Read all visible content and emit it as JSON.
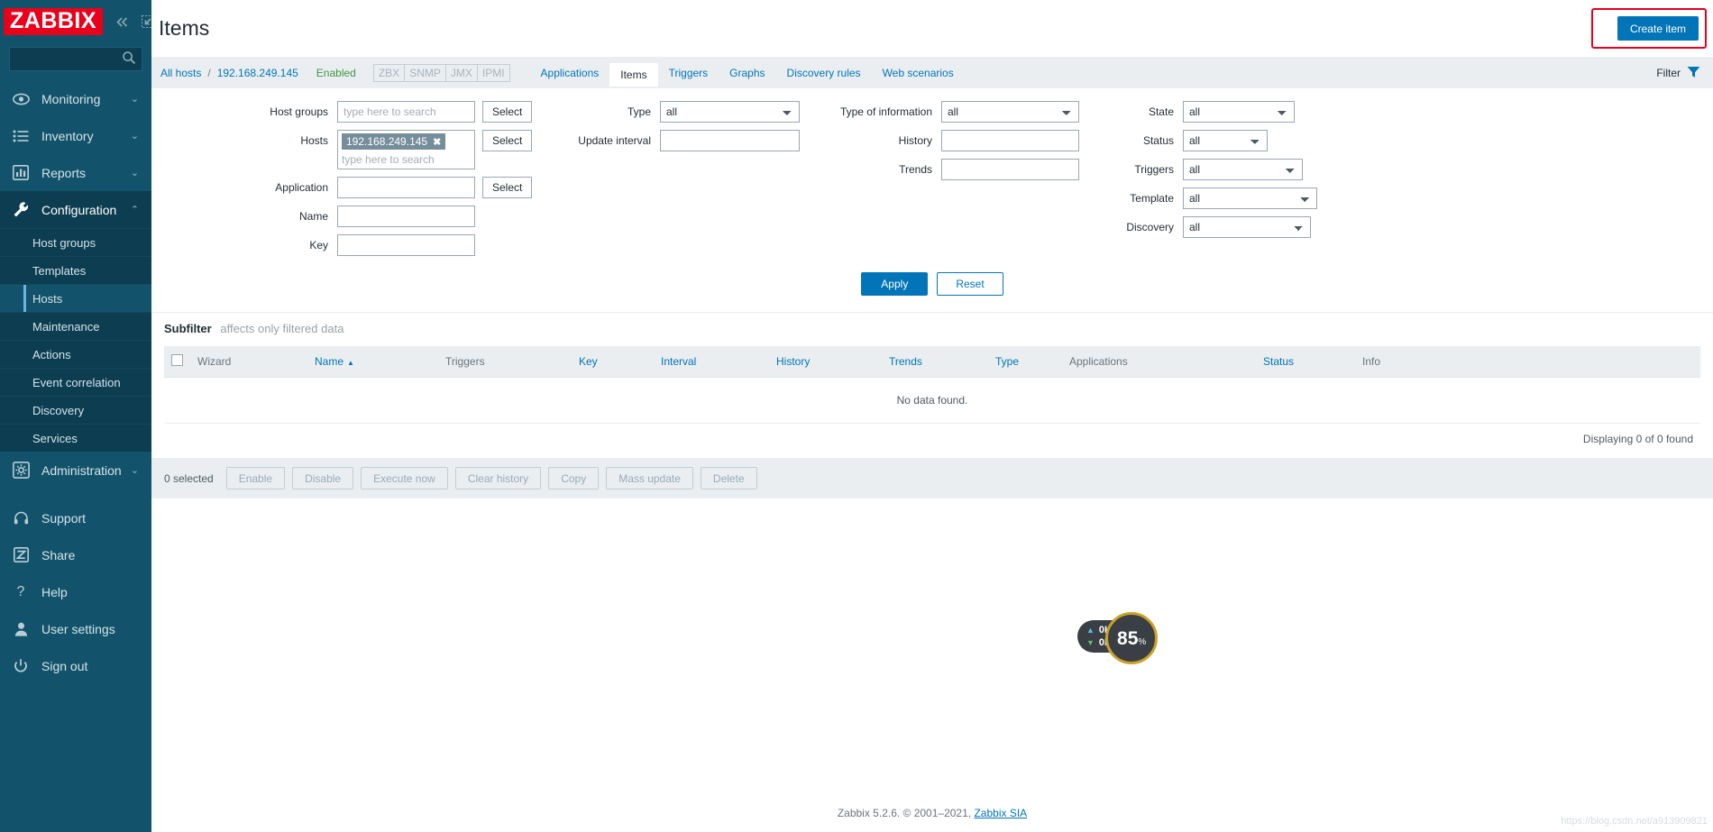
{
  "sidebar": {
    "logo": "ZABBIX",
    "collapse_icon": "chevron-double-left-icon",
    "expand_icon": "collapse-window-icon",
    "search": {
      "value": "",
      "placeholder": ""
    },
    "nav": [
      {
        "label": "Monitoring",
        "icon": "eye-icon",
        "chevron": "⌄",
        "active": false
      },
      {
        "label": "Inventory",
        "icon": "list-icon",
        "chevron": "⌄",
        "active": false
      },
      {
        "label": "Reports",
        "icon": "bar-chart-icon",
        "chevron": "⌄",
        "active": false
      },
      {
        "label": "Configuration",
        "icon": "wrench-icon",
        "chevron": "⌃",
        "active": true
      }
    ],
    "submenu": [
      {
        "label": "Host groups",
        "selected": false
      },
      {
        "label": "Templates",
        "selected": false
      },
      {
        "label": "Hosts",
        "selected": true
      },
      {
        "label": "Maintenance",
        "selected": false
      },
      {
        "label": "Actions",
        "selected": false
      },
      {
        "label": "Event correlation",
        "selected": false
      },
      {
        "label": "Discovery",
        "selected": false
      },
      {
        "label": "Services",
        "selected": false
      }
    ],
    "nav_admin": {
      "label": "Administration",
      "icon": "gear-icon",
      "chevron": "⌄"
    },
    "bottom": [
      {
        "label": "Support",
        "icon": "headset-icon"
      },
      {
        "label": "Share",
        "icon": "zabbix-z-icon"
      },
      {
        "label": "Help",
        "icon": "question-icon"
      },
      {
        "label": "User settings",
        "icon": "person-icon"
      },
      {
        "label": "Sign out",
        "icon": "power-icon"
      }
    ]
  },
  "header": {
    "title": "Items",
    "create_button": "Create item"
  },
  "breadcrumb": {
    "all_hosts": "All hosts",
    "separator": "/",
    "host": "192.168.249.145",
    "status": "Enabled",
    "interfaces": [
      "ZBX",
      "SNMP",
      "JMX",
      "IPMI"
    ]
  },
  "tabs": [
    {
      "label": "Applications",
      "active": false
    },
    {
      "label": "Items",
      "active": true
    },
    {
      "label": "Triggers",
      "active": false
    },
    {
      "label": "Graphs",
      "active": false
    },
    {
      "label": "Discovery rules",
      "active": false
    },
    {
      "label": "Web scenarios",
      "active": false
    }
  ],
  "filter_tab": {
    "label": "Filter",
    "icon": "funnel-icon"
  },
  "filter": {
    "col1": [
      {
        "label": "Host groups",
        "type": "multiselect",
        "value": "",
        "placeholder": "type here to search",
        "button": "Select"
      },
      {
        "label": "Hosts",
        "type": "multiselect-chip",
        "chip": "192.168.249.145",
        "value": "",
        "placeholder": "type here to search",
        "button": "Select"
      },
      {
        "label": "Application",
        "type": "text",
        "value": "",
        "button": "Select"
      },
      {
        "label": "Name",
        "type": "text",
        "value": ""
      },
      {
        "label": "Key",
        "type": "text",
        "value": ""
      }
    ],
    "col2": [
      {
        "label": "Type",
        "type": "select",
        "value": "all"
      },
      {
        "label": "Update interval",
        "type": "text",
        "value": ""
      }
    ],
    "col3": [
      {
        "label": "Type of information",
        "type": "select",
        "value": "all"
      },
      {
        "label": "History",
        "type": "text",
        "value": ""
      },
      {
        "label": "Trends",
        "type": "text",
        "value": ""
      }
    ],
    "col4": [
      {
        "label": "State",
        "type": "select",
        "value": "all"
      },
      {
        "label": "Status",
        "type": "select",
        "value": "all"
      },
      {
        "label": "Triggers",
        "type": "select",
        "value": "all"
      },
      {
        "label": "Template",
        "type": "select",
        "value": "all"
      },
      {
        "label": "Discovery",
        "type": "select",
        "value": "all"
      }
    ],
    "apply": "Apply",
    "reset": "Reset"
  },
  "subfilter": {
    "title": "Subfilter",
    "note": "affects only filtered data"
  },
  "table": {
    "columns": [
      {
        "label": "Wizard",
        "link": false,
        "sorted": false
      },
      {
        "label": "Name",
        "link": true,
        "sorted": true,
        "sort_arrow": "▲"
      },
      {
        "label": "Triggers",
        "link": false,
        "sorted": false
      },
      {
        "label": "Key",
        "link": true,
        "sorted": false
      },
      {
        "label": "Interval",
        "link": true,
        "sorted": false
      },
      {
        "label": "History",
        "link": true,
        "sorted": false
      },
      {
        "label": "Trends",
        "link": true,
        "sorted": false
      },
      {
        "label": "Type",
        "link": true,
        "sorted": false
      },
      {
        "label": "Applications",
        "link": false,
        "sorted": false
      },
      {
        "label": "Status",
        "link": true,
        "sorted": false
      },
      {
        "label": "Info",
        "link": false,
        "sorted": false
      }
    ],
    "empty_message": "No data found.",
    "displaying": "Displaying 0 of 0 found"
  },
  "actionbar": {
    "selected_count": "0 selected",
    "buttons": [
      "Enable",
      "Disable",
      "Execute now",
      "Clear history",
      "Copy",
      "Mass update",
      "Delete"
    ]
  },
  "footer": {
    "text": "Zabbix 5.2.6. © 2001–2021,",
    "link": "Zabbix SIA"
  },
  "widget": {
    "upload": "0K/s",
    "download": "0K/s",
    "percent": "85",
    "percent_unit": "%",
    "up_icon": "arrow-up-icon",
    "down_icon": "arrow-down-icon"
  },
  "watermark": "https://blog.csdn.net/a913909821",
  "colors": {
    "brand_red": "#e8001c",
    "sidebar_bg": "#12536b",
    "accent_blue": "#0275b8",
    "status_green": "#3f9643"
  }
}
